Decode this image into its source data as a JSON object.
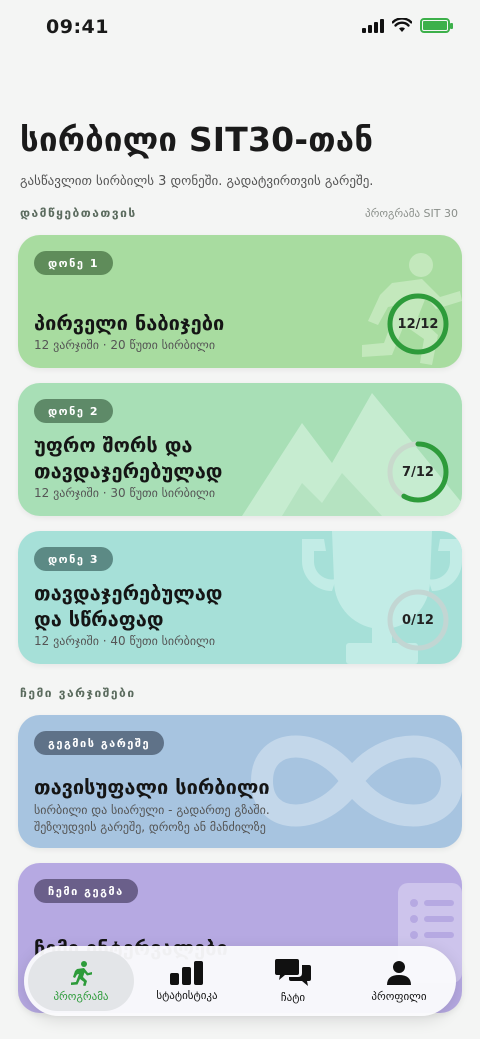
{
  "status": {
    "time": "09:41"
  },
  "header": {
    "title": "სირბილი SIT30-თან",
    "subtitle": "გასწავლით სირბილს 3 დონეში. გადატვირთვის გარეშე."
  },
  "sections": {
    "beginners": {
      "heading": "დამწყებთათვის",
      "meta": "პროგრამა SIT 30"
    },
    "mine": {
      "heading": "ჩემი ვარჯიშები"
    }
  },
  "levels": [
    {
      "badge": "დონე 1",
      "title": "პირველი ნაბიჯები",
      "subtitle": "12 ვარჯიში · 20 წუთი სირბილი",
      "progress_label": "12/12",
      "progress": 1.0
    },
    {
      "badge": "დონე 2",
      "title_line1": "უფრო შორს და",
      "title_line2": "თავდაჯერებულად",
      "subtitle": "12 ვარჯიში · 30 წუთი სირბილი",
      "progress_label": "7/12",
      "progress": 0.5833
    },
    {
      "badge": "დონე 3",
      "title_line1": "თავდაჯერებულად",
      "title_line2": "და სწრაფად",
      "subtitle": "12 ვარჯიში · 40 წუთი სირბილი",
      "progress_label": "0/12",
      "progress": 0
    }
  ],
  "workouts": [
    {
      "badge": "გეგმის გარეშე",
      "title": "თავისუფალი სირბილი",
      "desc_line1": "სირბილი და სიარული - გადართე გზაში.",
      "desc_line2": "შეზღუდვის გარეშე, დროზე ან მანძილზე"
    },
    {
      "badge": "ჩემი გეგმა",
      "title": "ჩემი ინტერვალები"
    }
  ],
  "nav": [
    {
      "label": "პროგრამა",
      "active": true
    },
    {
      "label": "სტატისტიკა"
    },
    {
      "label": "ჩატი"
    },
    {
      "label": "პროფილი"
    }
  ],
  "colors": {
    "level1_bg": "#a8dca0",
    "level2_bg": "#a8dfb6",
    "level3_bg": "#a6e0d8",
    "free_bg": "#a7c4e0",
    "plan_bg": "#b6a9e2",
    "accent": "#2d9b3a"
  }
}
